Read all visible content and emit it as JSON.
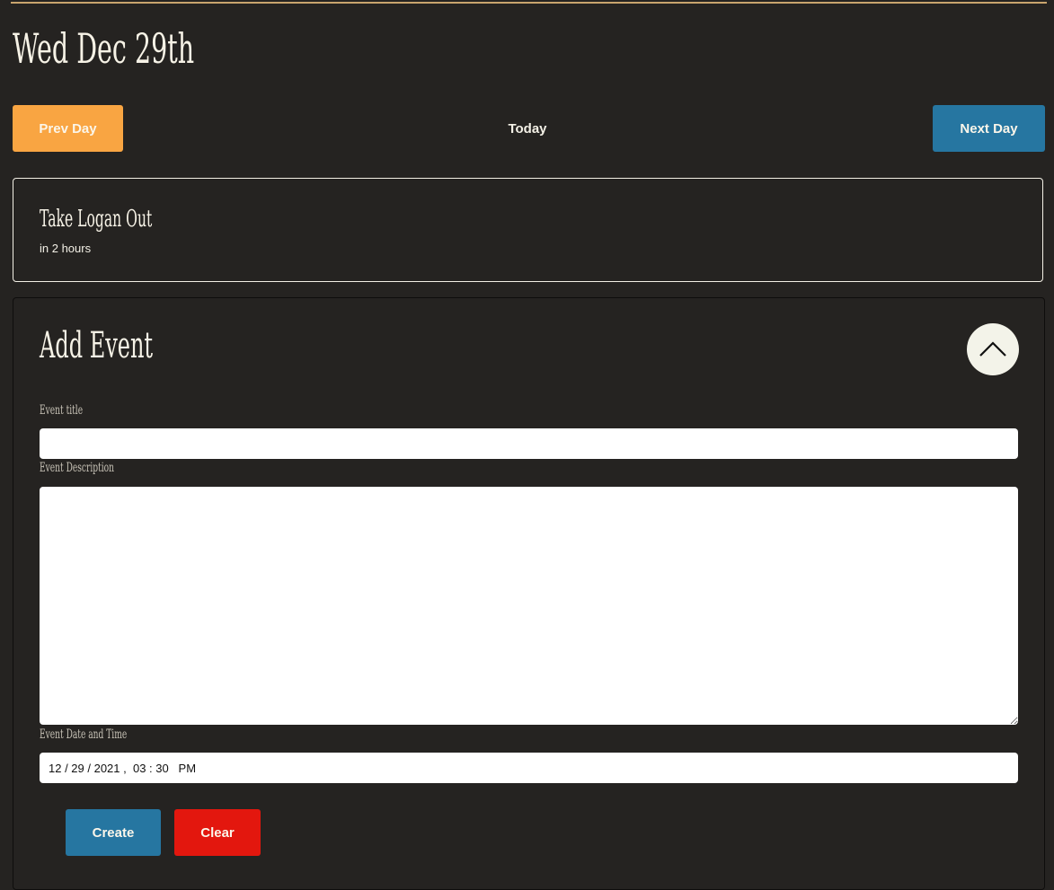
{
  "header": {
    "date_title": "Wed Dec 29th"
  },
  "nav": {
    "prev_label": "Prev Day",
    "today_label": "Today",
    "next_label": "Next Day"
  },
  "events": [
    {
      "title": "Take Logan Out",
      "relative_time": "in 2 hours"
    }
  ],
  "add_event": {
    "heading": "Add Event",
    "collapse_icon": "chevron-up-icon",
    "fields": {
      "title_label": "Event title",
      "title_value": "",
      "description_label": "Event Description",
      "description_value": "",
      "datetime_label": "Event Date and Time",
      "datetime_value": "12 / 29 / 2021 ,  03 : 30   PM"
    },
    "create_label": "Create",
    "clear_label": "Clear"
  },
  "colors": {
    "background": "#252321",
    "prev_button": "#f9a542",
    "next_button": "#2676a1",
    "create_button": "#2676a1",
    "clear_button": "#e3170e",
    "accent_rule": "#c9a46d"
  }
}
